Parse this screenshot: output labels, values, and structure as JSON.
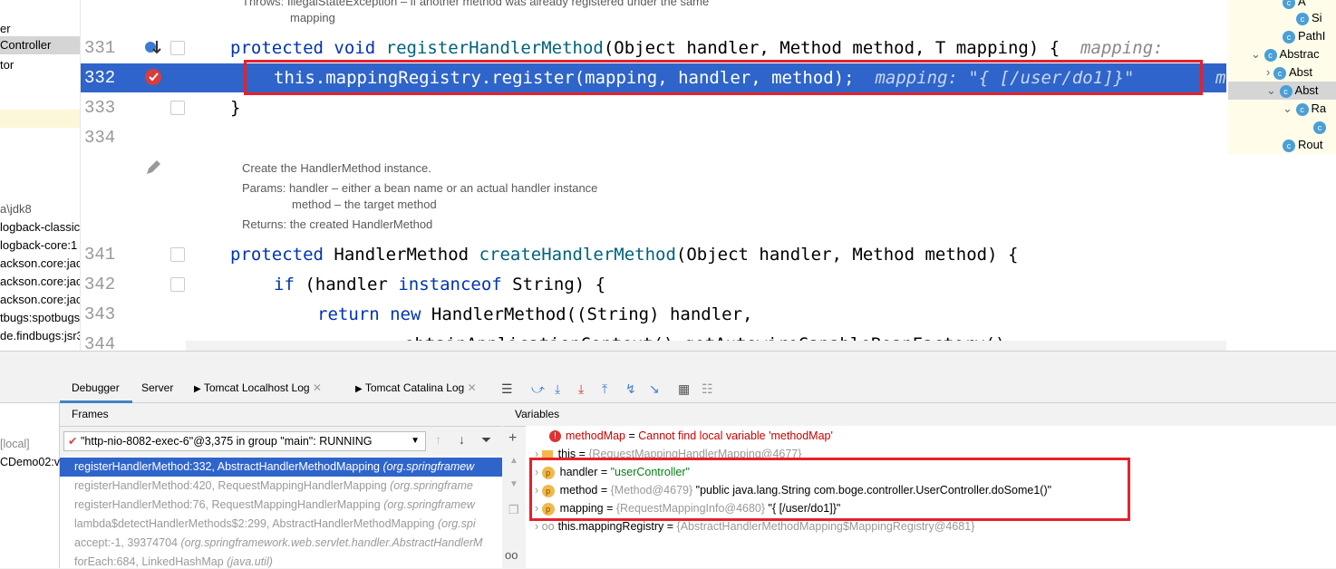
{
  "project_panel": {
    "items": [
      "er",
      "Controller",
      "tor",
      "a\\jdk8",
      "logback-classic",
      "logback-core:1",
      "ackson.core:jack",
      "ackson.core:jack",
      "ackson.core:jack",
      "tbugs:spotbugs",
      "de.findbugs:jsr3"
    ]
  },
  "editor": {
    "doc_top_line1": "Throws: IllegalStateException – if another method was already registered under the same",
    "doc_top_line2": "mapping",
    "line_numbers": [
      "331",
      "332",
      "333",
      "334",
      "341",
      "342",
      "343",
      "344"
    ],
    "line331": {
      "kw1": "protected",
      "kw2": "void",
      "fn": "registerHandlerMethod",
      "rest": "(Object handler, Method method, T mapping) {",
      "hint": "mapping:"
    },
    "line332": {
      "code": "this.mappingRegistry.register(mapping, handler, method);",
      "hint": "mapping: \"{ [/user/do1]}\"",
      "hint_tail": "m"
    },
    "line333": "}",
    "doc_mid": {
      "line1": "Create the HandlerMethod instance.",
      "line2": "Params: handler – either a bean name or an actual handler instance",
      "line3": "method – the target method",
      "line4": "Returns: the created HandlerMethod"
    },
    "line341": {
      "kw": "protected",
      "type": "HandlerMethod",
      "fn": "createHandlerMethod",
      "rest": "(Object handler, Method method) {"
    },
    "line342": {
      "kw1": "if",
      "mid": "(handler",
      "kw2": "instanceof",
      "rest": "String) {"
    },
    "line343": {
      "kw1": "return",
      "kw2": "new",
      "rest": "HandlerMethod((String) handler,"
    },
    "line344": "obtainApplicationContext().getAutowireCapableBeanFactory(),"
  },
  "structure_panel": {
    "items": [
      "A",
      "Si",
      "PathI",
      "Abstrac",
      "Abst",
      "Abst",
      "Ra",
      "Rout"
    ]
  },
  "debugger": {
    "tabs": [
      "Debugger",
      "Server",
      "Tomcat Localhost Log",
      "Tomcat Catalina Log"
    ],
    "frames_label": "Frames",
    "variables_label": "Variables",
    "left_items": [
      "[local]",
      "CDemo02:v"
    ],
    "thread": "\"http-nio-8082-exec-6\"@3,375 in group \"main\": RUNNING",
    "frames": [
      {
        "method": "registerHandlerMethod:332, AbstractHandlerMethodMapping",
        "pkg": "(org.springframew"
      },
      {
        "method": "registerHandlerMethod:420, RequestMappingHandlerMapping",
        "pkg": "(org.springframe"
      },
      {
        "method": "registerHandlerMethod:76, RequestMappingHandlerMapping",
        "pkg": "(org.springframew"
      },
      {
        "method": "lambda$detectHandlerMethods$2:299, AbstractHandlerMethodMapping",
        "pkg": "(org.spi"
      },
      {
        "method": "accept:-1, 39374704",
        "pkg": "(org.springframework.web.servlet.handler.AbstractHandlerM"
      },
      {
        "method": "forEach:684, LinkedHashMap",
        "pkg": "(java.util)"
      }
    ],
    "variables": [
      {
        "name": "methodMap",
        "eq": " = ",
        "value": "Cannot find local variable 'methodMap'",
        "kind": "error"
      },
      {
        "name": "this",
        "eq": " = ",
        "value": "{RequestMappingHandlerMapping@4677}",
        "kind": "this"
      },
      {
        "name": "handler",
        "eq": " = ",
        "value": "\"userController\"",
        "kind": "p"
      },
      {
        "name": "method",
        "eq": " = ",
        "ref": "{Method@4679}",
        "value": "\"public java.lang.String com.boge.controller.UserController.doSome1()\"",
        "kind": "p"
      },
      {
        "name": "mapping",
        "eq": " = ",
        "ref": "{RequestMappingInfo@4680}",
        "value": "\"{ [/user/do1]}\"",
        "kind": "p"
      },
      {
        "name": "this.mappingRegistry",
        "eq": " = ",
        "value": "{AbstractHandlerMethodMapping$MappingRegistry@4681}",
        "kind": "oo"
      }
    ]
  },
  "colors": {
    "selection": "#2f65ca",
    "highlight_box": "#e8202a",
    "keyword": "#0033b3",
    "method": "#00627a"
  }
}
